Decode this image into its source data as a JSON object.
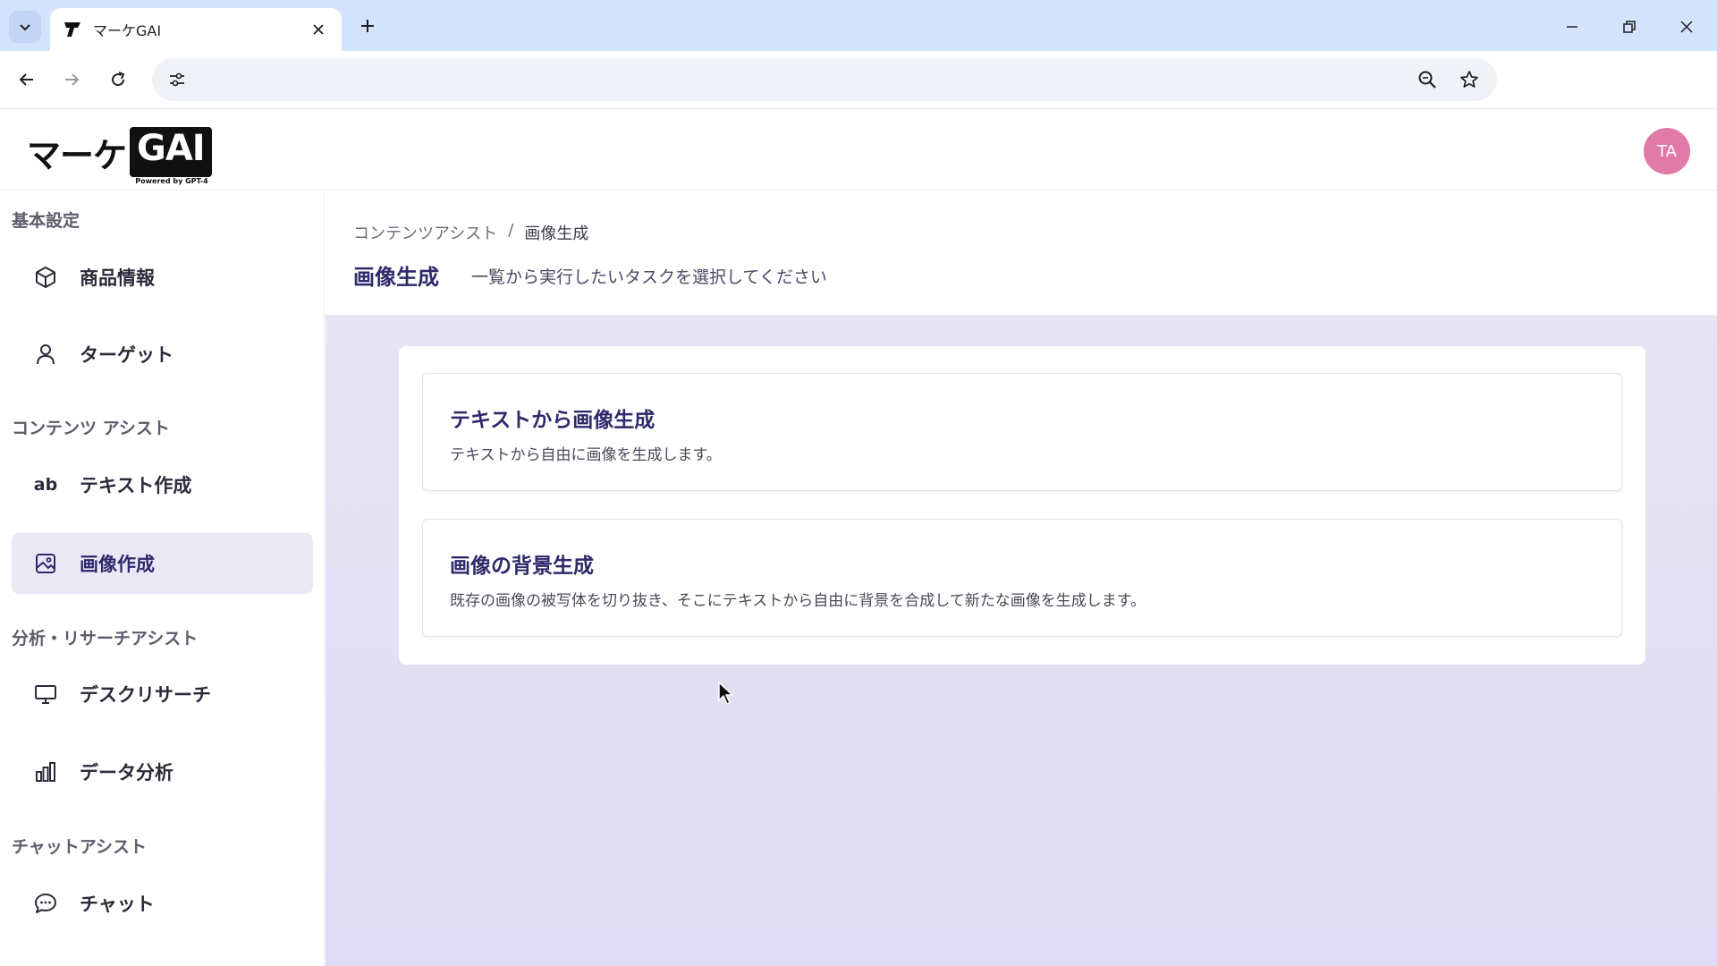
{
  "browser": {
    "tab_title": "マーケGAI",
    "address": ""
  },
  "app": {
    "logo_kana": "マーケ",
    "logo_gai": "GAI",
    "logo_powered": "Powered by GPT-4",
    "avatar_initials": "TA",
    "avatar_color": "#e07ba7",
    "accent_color": "#2e2a6b"
  },
  "sidebar": {
    "sections": [
      {
        "title": "基本設定"
      },
      {
        "title": "コンテンツ アシスト"
      },
      {
        "title": "分析・リサーチアシスト"
      },
      {
        "title": "チャットアシスト"
      }
    ],
    "items": [
      {
        "label": "商品情報",
        "icon": "cube-icon"
      },
      {
        "label": "ターゲット",
        "icon": "person-icon"
      },
      {
        "label": "テキスト作成",
        "icon": "ab-text-icon"
      },
      {
        "label": "画像作成",
        "icon": "image-icon",
        "active": true
      },
      {
        "label": "デスクリサーチ",
        "icon": "monitor-icon"
      },
      {
        "label": "データ分析",
        "icon": "bar-chart-icon"
      },
      {
        "label": "チャット",
        "icon": "chat-bubble-icon"
      }
    ]
  },
  "page": {
    "breadcrumb": [
      "コンテンツアシスト",
      "/",
      "画像生成"
    ],
    "title": "画像生成",
    "description": "一覧から実行したいタスクを選択してください"
  },
  "cards": [
    {
      "title": "テキストから画像生成",
      "description": "テキストから自由に画像を生成します。"
    },
    {
      "title": "画像の背景生成",
      "description": "既存の画像の被写体を切り抜き、そこにテキストから自由に背景を合成して新たな画像を生成します。"
    }
  ]
}
